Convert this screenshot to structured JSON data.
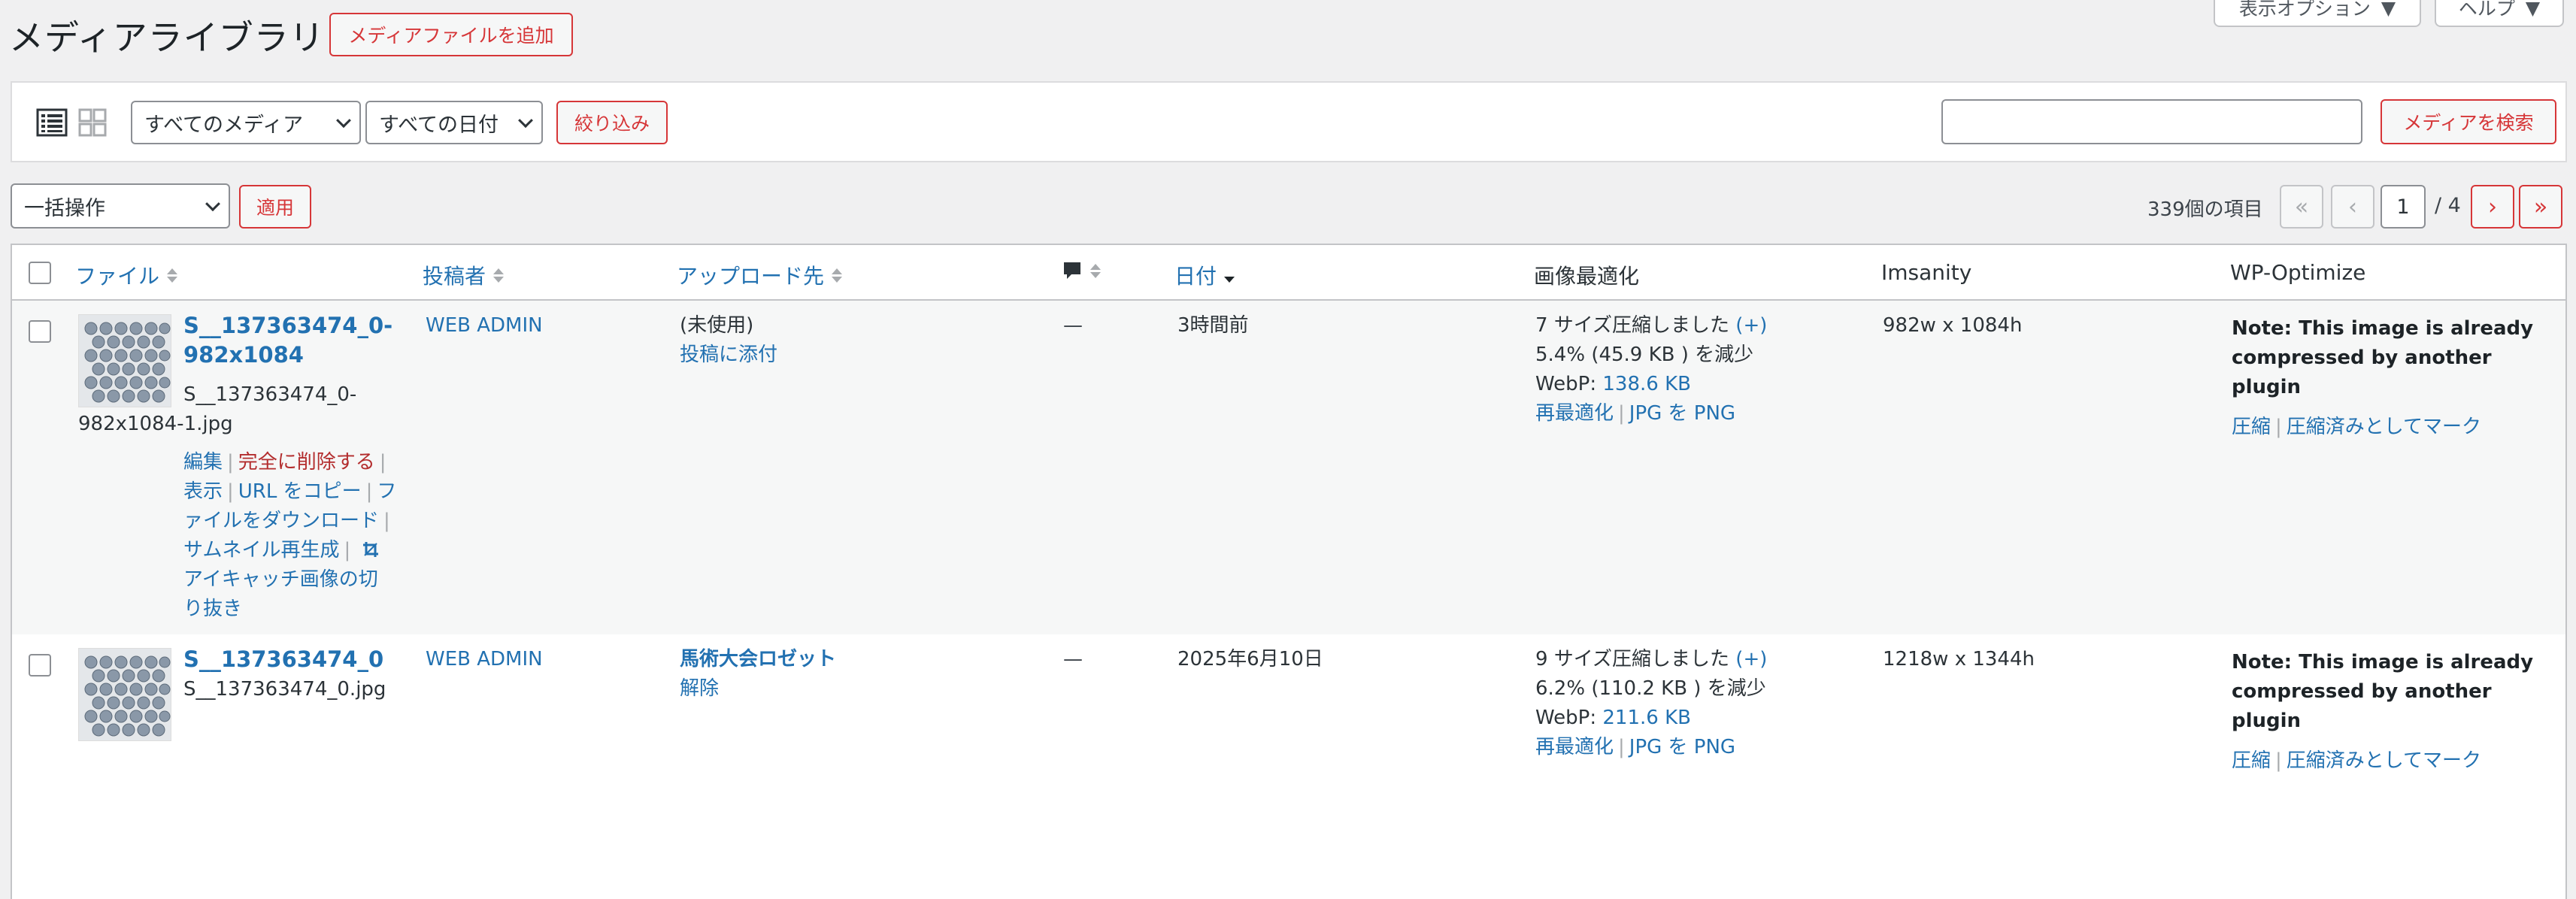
{
  "header": {
    "title": "メディアライブラリ",
    "add_button": "メディアファイルを追加",
    "screen_options": "表示オプション",
    "help": "ヘルプ"
  },
  "filters": {
    "media_type": "すべてのメディア",
    "date": "すべての日付",
    "filter_button": "絞り込み",
    "search_value": "",
    "search_button": "メディアを検索"
  },
  "bulk": {
    "action": "一括操作",
    "apply": "適用"
  },
  "pagination": {
    "count": "339個の項目",
    "first": "«",
    "prev": "‹",
    "current": "1",
    "total": "/ 4",
    "next": "›",
    "last": "»"
  },
  "columns": {
    "file": "ファイル",
    "author": "投稿者",
    "uploaded_to": "アップロード先",
    "date": "日付",
    "image_opt": "画像最適化",
    "imsanity": "Imsanity",
    "wpo": "WP-Optimize"
  },
  "rows": [
    {
      "title_line1": "S__137363474_0-",
      "title_line2": "982x1084",
      "filename_line1": "S__137363474_0-",
      "filename_line2": "982x1084-1.jpg",
      "actions": {
        "edit": "編集",
        "delete": "完全に削除する",
        "view": "表示",
        "copy_url": "URL をコピー",
        "download_a": "フ",
        "download_b": "ァイルをダウンロード",
        "regen": "サムネイル再生成",
        "crop_a": "アイキャッチ画像の切",
        "crop_b": "り抜き"
      },
      "author": "WEB ADMIN",
      "uploaded_status": "(未使用)",
      "uploaded_action": "投稿に添付",
      "comments": "—",
      "date": "3時間前",
      "opt_line1": "7 サイズ圧縮しました",
      "opt_plus": "(+)",
      "opt_line2": "5.4% (45.9 KB ) を減少",
      "webp_label": "WebP:",
      "webp_size": "138.6 KB",
      "reoptimize": "再最適化",
      "jpg_png": "JPG を PNG",
      "imsanity": "982w x 1084h",
      "wpo_note_1": "Note: This image is already",
      "wpo_note_2": "compressed by another plugin",
      "wpo_compress": "圧縮",
      "wpo_mark": "圧縮済みとしてマーク"
    },
    {
      "title_line1": "S__137363474_0",
      "filename_line1": "S__137363474_0.jpg",
      "actions": {},
      "author": "WEB ADMIN",
      "uploaded_status": "馬術大会ロゼット",
      "uploaded_action": "解除",
      "comments": "—",
      "date": "2025年6月10日",
      "opt_line1": "9 サイズ圧縮しました",
      "opt_plus": "(+)",
      "opt_line2": "6.2% (110.2 KB ) を減少",
      "webp_label": "WebP:",
      "webp_size": "211.6 KB",
      "reoptimize": "再最適化",
      "jpg_png": "JPG を PNG",
      "imsanity": "1218w x 1344h",
      "wpo_note_1": "Note: This image is already",
      "wpo_note_2": "compressed by another plugin",
      "wpo_compress": "圧縮",
      "wpo_mark": "圧縮済みとしてマーク"
    }
  ]
}
